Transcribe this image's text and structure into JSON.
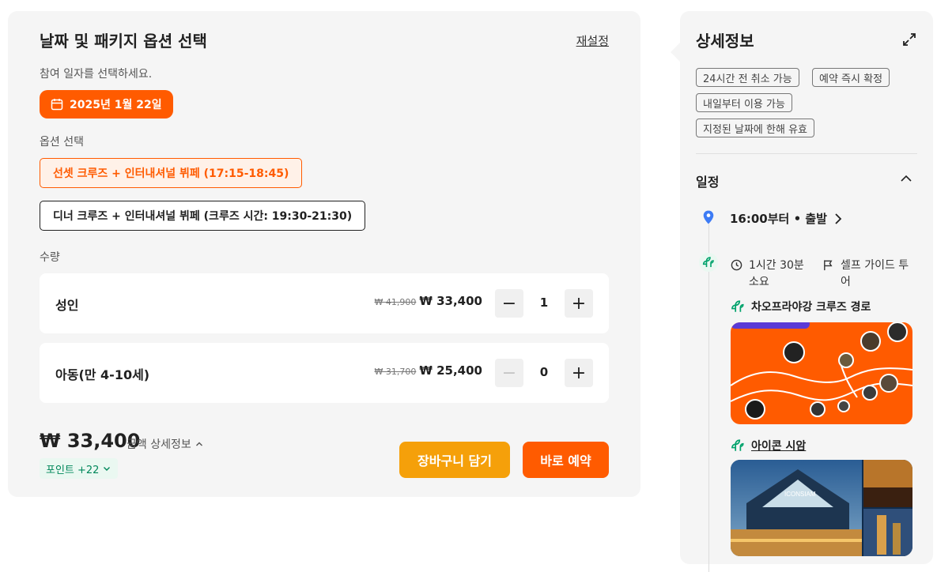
{
  "left": {
    "title": "날짜 및 패키지 옵션 선택",
    "reset": "재설정",
    "date_prompt": "참여 일자를 선택하세요.",
    "selected_date": "2025년 1월 22일",
    "option_prompt": "옵션 선택",
    "options": [
      {
        "label": "선셋 크루즈 + 인터내셔널 뷔페 (17:15-18:45)",
        "selected": true
      },
      {
        "label": "디너 크루즈 + 인터내셔널 뷔페 (크루즈 시간: 19:30-21:30)",
        "selected": false
      }
    ],
    "quantity_label": "수량",
    "quantities": [
      {
        "label": "성인",
        "old_price": "₩ 41,900",
        "price": "₩ 33,400",
        "count": "1",
        "minus": "−",
        "plus": "+"
      },
      {
        "label": "아동(만 4-10세)",
        "old_price": "₩ 31,700",
        "price": "₩ 25,400",
        "count": "0",
        "minus": "−",
        "plus": "+"
      }
    ],
    "total": "₩ 33,400",
    "price_detail": "금액 상세정보",
    "points": "포인트 +22",
    "cart_button": "장바구니 담기",
    "book_button": "바로 예약"
  },
  "right": {
    "title": "상세정보",
    "tags": [
      "24시간 전 취소 가능",
      "예약 즉시 확정",
      "내일부터 이용 가능",
      "지정된 날짜에 한해 유효"
    ],
    "schedule_title": "일정",
    "departure": "16:00부터 • 출발",
    "duration": "1시간 30분 소요",
    "tour_type": "셀프 가이드 투어",
    "route_title": "차오프라야강 크루즈 경로",
    "landmark_title": "아이콘 시암",
    "photo_sign": "ICONSIAM"
  },
  "colors": {
    "accent": "#ff5b00",
    "cart": "#f5a00a",
    "green": "#00875a",
    "panel": "#f5f5f5"
  },
  "icons": [
    "calendar-icon",
    "expand-icon",
    "chevron-up-icon",
    "location-pin-icon",
    "chevron-right-icon",
    "leaf-icon",
    "clock-icon",
    "flag-icon"
  ]
}
